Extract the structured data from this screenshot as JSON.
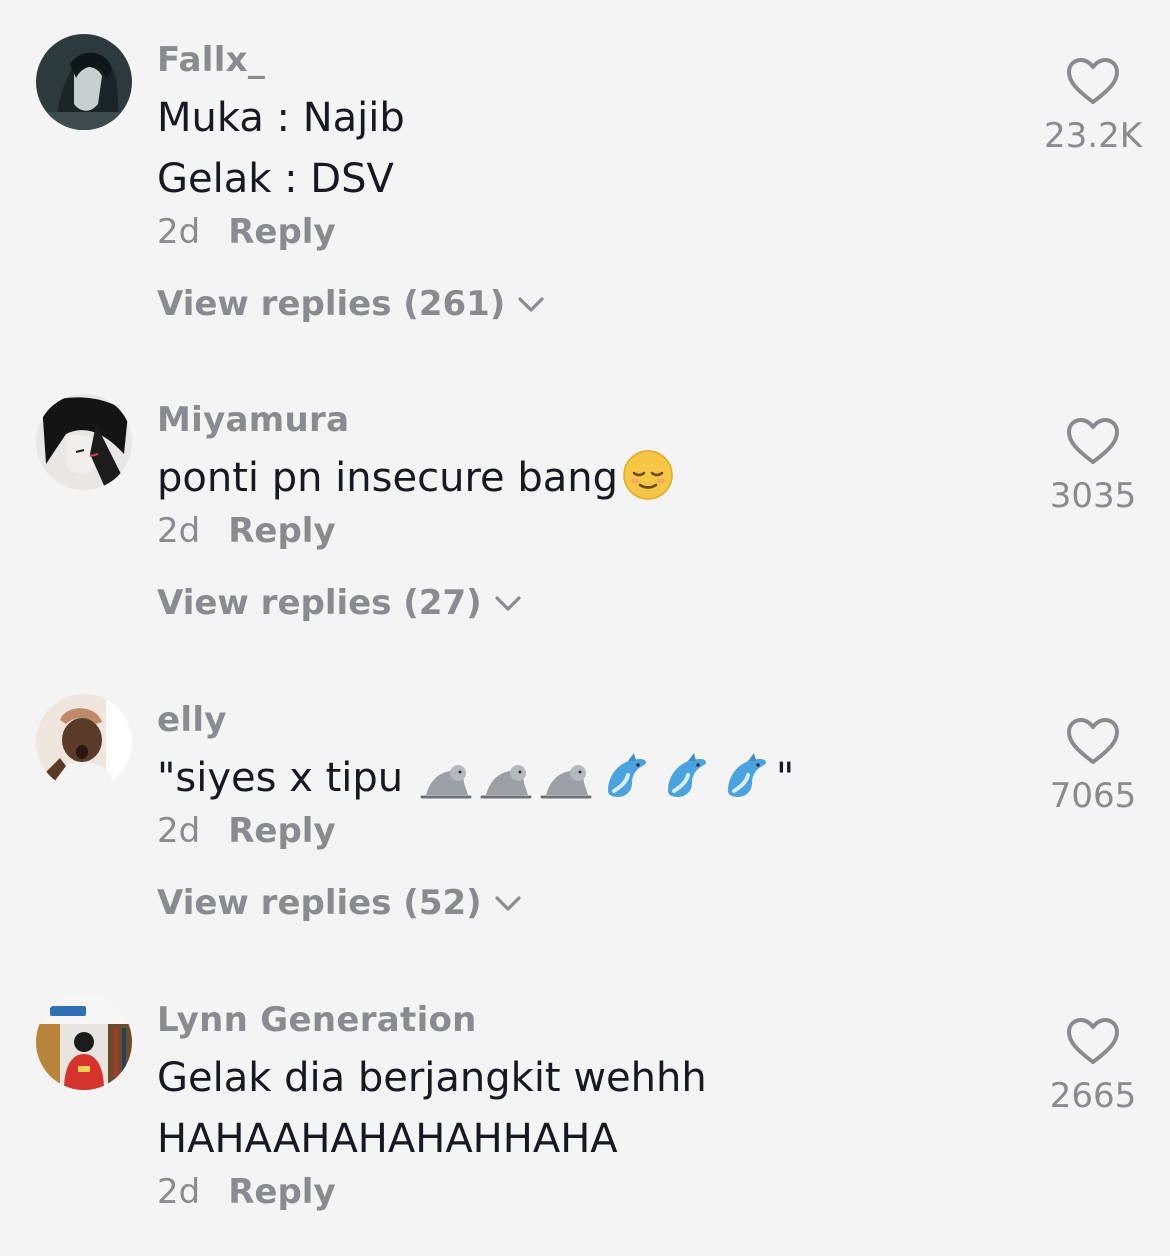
{
  "comments": [
    {
      "username": "Fallx_",
      "lines": [
        "Muka : Najib",
        "Gelak : DSV"
      ],
      "time": "2d",
      "reply_label": "Reply",
      "view_replies": "View replies (261)",
      "likes": "23.2K"
    },
    {
      "username": "Miyamura",
      "text": "ponti pn insecure bang",
      "time": "2d",
      "reply_label": "Reply",
      "view_replies": "View replies (27)",
      "likes": "3035"
    },
    {
      "username": "elly",
      "text_prefix": "\"siyes x tipu",
      "text_suffix": "\"",
      "time": "2d",
      "reply_label": "Reply",
      "view_replies": "View replies (52)",
      "likes": "7065"
    },
    {
      "username": "Lynn Generation",
      "lines": [
        "Gelak dia berjangkit wehhh",
        "HAHAAHAHAHAHHAHA"
      ],
      "time": "2d",
      "reply_label": "Reply",
      "likes": "2665"
    }
  ],
  "icons": {
    "like": "heart-outline-icon",
    "expand": "chevron-down-icon",
    "emoji_relieved": "relieved-face-emoji",
    "emoji_seal": "seal-emoji",
    "emoji_dolphin": "dolphin-emoji"
  },
  "colors": {
    "background": "#f4f4f4",
    "primary_text": "#161823",
    "secondary_text": "#8a8b91"
  }
}
